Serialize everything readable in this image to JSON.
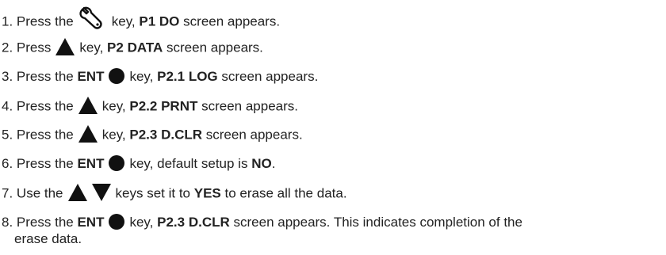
{
  "steps": [
    {
      "num": "1.",
      "t1": "Press the",
      "icon": "wrench-icon",
      "t2": "key,",
      "b1": "P1 DO",
      "t3": "screen appears."
    },
    {
      "num": "2.",
      "t1": "Press",
      "icon": "triangle-up-icon",
      "t2": "key,",
      "b1": "P2 DATA",
      "t3": "screen appears."
    },
    {
      "num": "3.",
      "t1": "Press the",
      "b0": "ENT",
      "icon": "enter-circle-icon",
      "t2": "key,",
      "b1": "P2.1 LOG",
      "t3": "screen appears."
    },
    {
      "num": "4.",
      "t1": "Press the",
      "icon": "triangle-up-icon",
      "t2": "key,",
      "b1": "P2.2 PRNT",
      "t3": "screen appears."
    },
    {
      "num": "5.",
      "t1": "Press the",
      "icon": "triangle-up-icon",
      "t2": "key,",
      "b1": "P2.3 D.CLR",
      "t3": "screen appears."
    },
    {
      "num": "6.",
      "t1": "Press the",
      "b0": "ENT",
      "icon": "enter-circle-icon",
      "t2": "key, default setup is",
      "b1": "NO",
      "t3": "."
    },
    {
      "num": "7.",
      "t1": "Use the",
      "icons": [
        "triangle-up-icon",
        "triangle-down-icon"
      ],
      "t2": "keys set it to",
      "b1": "YES",
      "t3": "to erase all the data."
    },
    {
      "num": "8.",
      "t1": "Press the",
      "b0": "ENT",
      "icon": "enter-circle-icon",
      "t2": "key,",
      "b1": "P2.3 D.CLR",
      "t3": "screen appears. This indicates completion of the",
      "t4": "erase data."
    }
  ]
}
